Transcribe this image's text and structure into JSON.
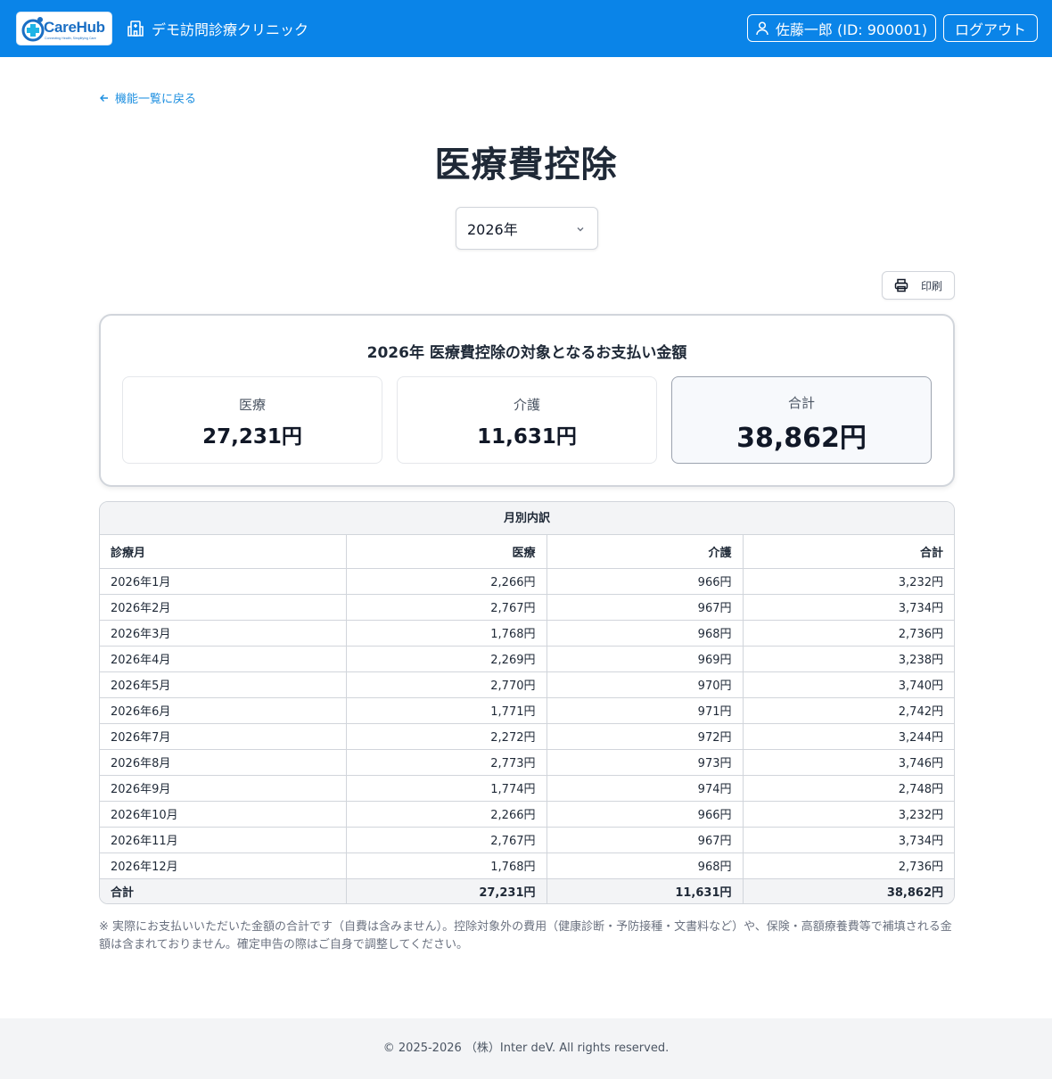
{
  "header": {
    "logo_text": "CareHub",
    "logo_tagline": "Connecting Health, Simplifying Care",
    "clinic_name": "デモ訪問診療クリニック",
    "user_label": "佐藤一郎 (ID: 900001)",
    "logout_label": "ログアウト"
  },
  "nav": {
    "back_label": "機能一覧に戻る"
  },
  "page": {
    "title": "医療費控除"
  },
  "year_select": {
    "selected": "2026年"
  },
  "toolbar": {
    "print_label": "印刷"
  },
  "summary": {
    "title": "2026年 医療費控除の対象となるお支払い金額",
    "medical": {
      "label": "医療",
      "value": "27,231円"
    },
    "care": {
      "label": "介護",
      "value": "11,631円"
    },
    "total": {
      "label": "合計",
      "value": "38,862円"
    }
  },
  "breakdown": {
    "caption": "月別内訳",
    "headers": [
      "診療月",
      "医療",
      "介護",
      "合計"
    ],
    "rows": [
      [
        "2026年1月",
        "2,266円",
        "966円",
        "3,232円"
      ],
      [
        "2026年2月",
        "2,767円",
        "967円",
        "3,734円"
      ],
      [
        "2026年3月",
        "1,768円",
        "968円",
        "2,736円"
      ],
      [
        "2026年4月",
        "2,269円",
        "969円",
        "3,238円"
      ],
      [
        "2026年5月",
        "2,770円",
        "970円",
        "3,740円"
      ],
      [
        "2026年6月",
        "1,771円",
        "971円",
        "2,742円"
      ],
      [
        "2026年7月",
        "2,272円",
        "972円",
        "3,244円"
      ],
      [
        "2026年8月",
        "2,773円",
        "973円",
        "3,746円"
      ],
      [
        "2026年9月",
        "1,774円",
        "974円",
        "2,748円"
      ],
      [
        "2026年10月",
        "2,266円",
        "966円",
        "3,232円"
      ],
      [
        "2026年11月",
        "2,767円",
        "967円",
        "3,734円"
      ],
      [
        "2026年12月",
        "1,768円",
        "968円",
        "2,736円"
      ]
    ],
    "total_row": [
      "合計",
      "27,231円",
      "11,631円",
      "38,862円"
    ]
  },
  "note": "※ 実際にお支払いいただいた金額の合計です（自費は含みません）。控除対象外の費用（健康診断・予防接種・文書料など）や、保険・高額療養費等で補填される金額は含まれておりません。確定申告の際はご自身で調整してください。",
  "footer": {
    "copyright": "© 2025-2026 （株）Inter deV. All rights reserved."
  },
  "icons": [
    "carehub-logo-icon",
    "hospital-icon",
    "user-icon",
    "arrow-left-icon",
    "chevron-down-icon",
    "printer-icon"
  ],
  "colors": {
    "header_bg": "#0a84e8",
    "link": "#1d8fe0"
  }
}
